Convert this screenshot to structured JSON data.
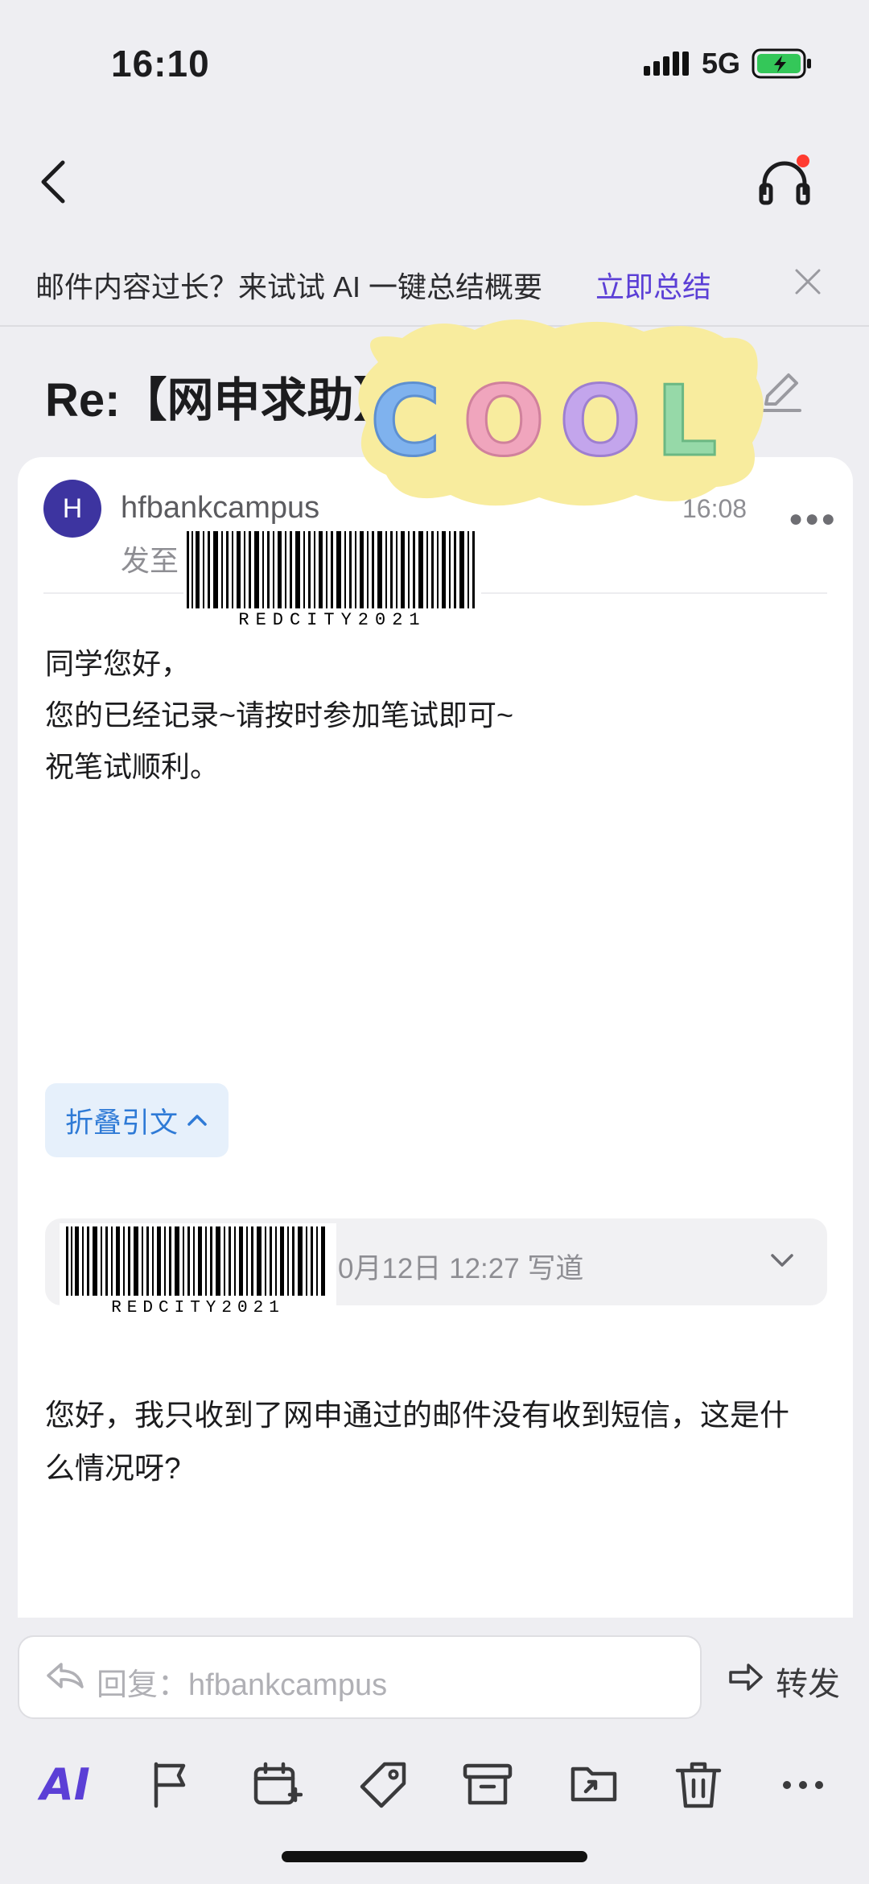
{
  "status_bar": {
    "time": "16:10",
    "network": "5G"
  },
  "ai_banner": {
    "text": "邮件内容过长？来试试 AI 一键总结概要",
    "action": "立即总结"
  },
  "email": {
    "subject": "Re:【网申求助】",
    "avatar_letter": "H",
    "sender": "hfbankcampus",
    "to_label": "发至",
    "time": "16:08",
    "barcode_text": "REDCITY2021",
    "body_lines": [
      "同学您好，",
      "您的已经记录~请按时参加笔试即可~",
      "祝笔试顺利。"
    ],
    "collapse_label": "折叠引文",
    "quote_header": "0月12日 12:27 写道",
    "quoted_lines": [
      "您好，我只收到了网申通过的邮件没有收到短信，这是什",
      "么情况呀?"
    ]
  },
  "sticker": {
    "text": "COOL"
  },
  "reply": {
    "placeholder": "回复：hfbankcampus",
    "forward_label": "转发"
  },
  "toolbar": {
    "ai_label": "AI",
    "icons": [
      "ai-icon",
      "flag-icon",
      "calendar-add-icon",
      "tag-icon",
      "archive-icon",
      "move-folder-icon",
      "trash-icon",
      "more-icon"
    ]
  },
  "colors": {
    "accent": "#5b3fd6",
    "link_blue": "#2e7ad6",
    "avatar": "#3d34a0",
    "battery": "#34c759"
  }
}
